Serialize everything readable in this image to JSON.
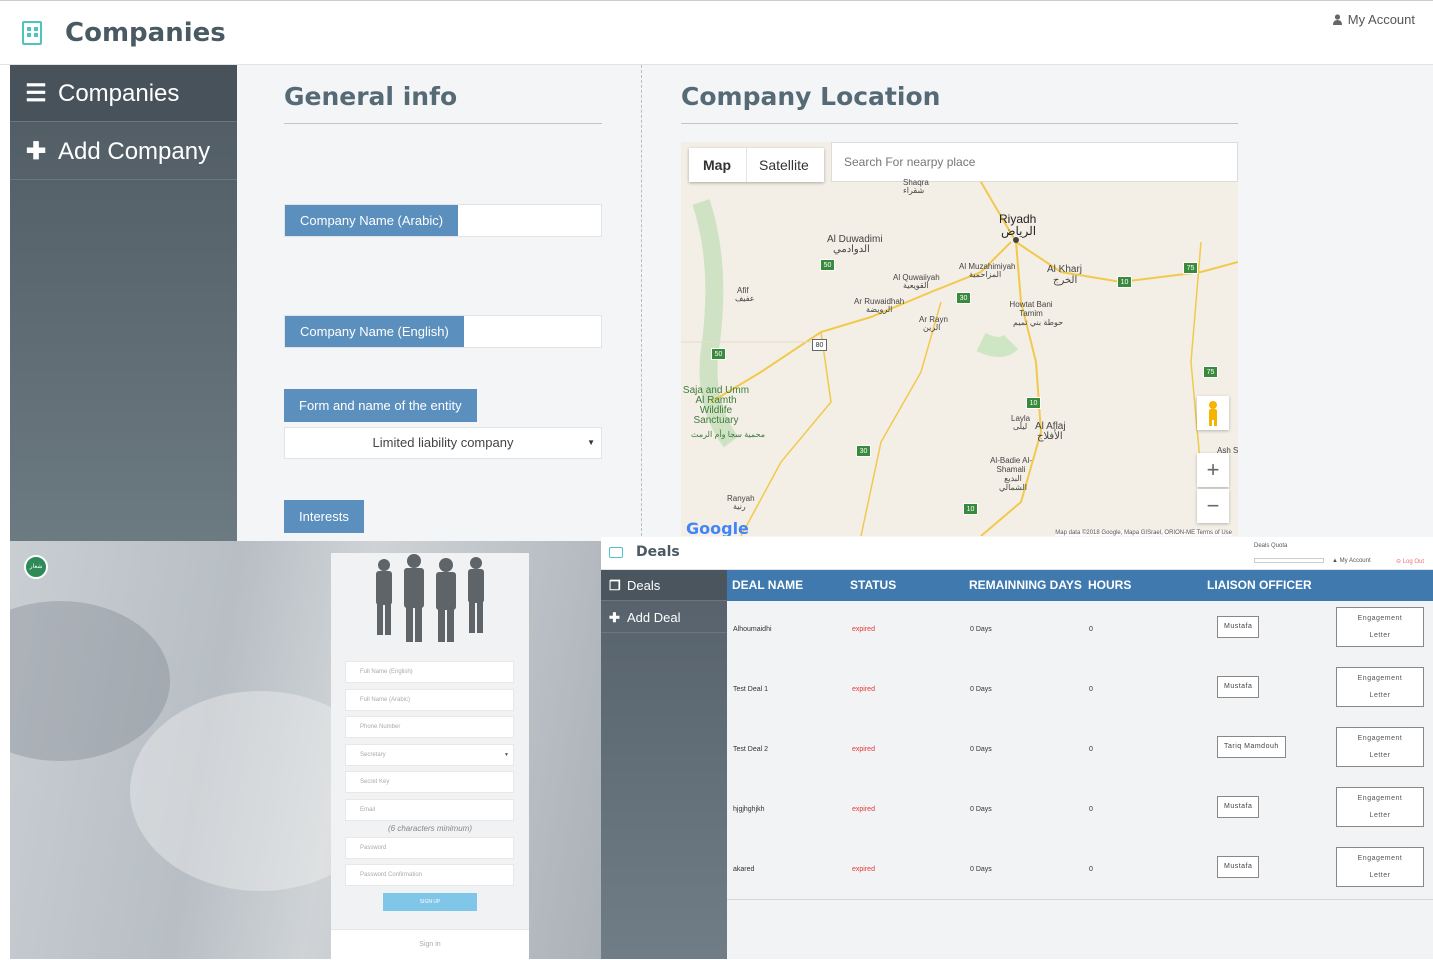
{
  "companies": {
    "header": {
      "title": "Companies",
      "account_label": "My Account"
    },
    "sidebar": {
      "items": [
        {
          "label": "Companies",
          "icon": "list-icon"
        },
        {
          "label": "Add Company",
          "icon": "plus-icon"
        }
      ]
    },
    "general_info": {
      "title": "General info",
      "company_name_arabic_label": "Company Name (Arabic)",
      "company_name_arabic_value": "",
      "company_name_english_label": "Company Name (English)",
      "company_name_english_value": "",
      "entity_label": "Form and name of the entity",
      "entity_value": "Limited liability company",
      "interests_label": "Interests"
    },
    "location": {
      "title": "Company Location",
      "search_placeholder": "Search For nearpy place",
      "map_type_map": "Map",
      "map_type_satellite": "Satellite",
      "zoom_in": "+",
      "zoom_out": "−",
      "google_logo": "Google",
      "attribution": "Map data ©2018 Google, Mapa GISrael, ORION-ME   Terms of Use",
      "places": {
        "riyadh": "Riyadh",
        "riyadh_ar": "الرياض",
        "al_duwadimi": "Al Duwadimi",
        "al_duwadimi_ar": "الدوادمي",
        "al_quwaiiyah": "Al Quwaiiyah",
        "al_quwaiiyah_ar": "القويعية",
        "al_muzahimiyah": "Al Muzahimiyah",
        "al_muzahimiyah_ar": "المزاحمية",
        "al_kharj": "Al Kharj",
        "al_kharj_ar": "الخرج",
        "afif": "Afif",
        "afif_ar": "عفيف",
        "ar_ruwaidhah": "Ar Ruwaidhah",
        "ar_ruwaidhah_ar": "الرويضة",
        "ar_rayn": "Ar Rayn",
        "ar_rayn_ar": "الرين",
        "howtat_bani_tamim": "Howtat Bani Tamim",
        "howtat_bani_tamim_ar": "حوطة بني تميم",
        "shaqra": "Shaqra",
        "shaqra_ar": "شقراء",
        "saja_umm_al_ramth": "Saja and Umm Al Ramth Wildlife Sanctuary",
        "saja_umm_al_ramth_ar": "محمية سجا وأم الرمث",
        "layla": "Layla",
        "layla_ar": "ليلى",
        "al_aflaj": "Al Aflaj",
        "al_aflaj_ar": "الأفلاج",
        "al_badie": "Al-Badie Al-Shamali",
        "al_badie_ar": "البديع الشمالي",
        "ranyah": "Ranyah",
        "ranyah_ar": "رنية",
        "ash_s": "Ash S"
      },
      "road_badges": [
        "50",
        "30",
        "80",
        "10",
        "75",
        "30",
        "10",
        "75",
        "10",
        "50",
        "30",
        "10"
      ]
    }
  },
  "signup": {
    "logo_text": "شعار",
    "fields": [
      "Full Name (English)",
      "Full Name (Arabic)",
      "Phone Number",
      "Secretary",
      "Secret Key",
      "Email"
    ],
    "password_hint": "(6 characters minimum)",
    "password_placeholder": "Password",
    "password_confirm_placeholder": "Password Confirmation",
    "submit_label": "SIGN UP",
    "footer_link": "Sign in"
  },
  "deals": {
    "header": {
      "title": "Deals",
      "quota_label": "Deals Quota",
      "account_label": "My Account",
      "logout_label": "Log Out"
    },
    "sidebar": {
      "items": [
        {
          "label": "Deals",
          "icon": "copy-icon"
        },
        {
          "label": "Add Deal",
          "icon": "plus-icon"
        }
      ]
    },
    "columns": [
      "DEAL NAME",
      "STATUS",
      "REMAINNING DAYS",
      "HOURS",
      "LIAISON OFFICER"
    ],
    "rows": [
      {
        "name": "Alhoumaidhi",
        "status": "expired",
        "days": "0 Days",
        "hours": "0",
        "officer": "Mustafa",
        "action": "Engagement Letter"
      },
      {
        "name": "Test Deal 1",
        "status": "expired",
        "days": "0 Days",
        "hours": "0",
        "officer": "Mustafa",
        "action": "Engagement Letter"
      },
      {
        "name": "Test Deal 2",
        "status": "expired",
        "days": "0 Days",
        "hours": "0",
        "officer": "Tariq Mamdouh",
        "action": "Engagement Letter"
      },
      {
        "name": "hjgjhghjkh",
        "status": "expired",
        "days": "0 Days",
        "hours": "0",
        "officer": "Mustafa",
        "action": "Engagement Letter"
      },
      {
        "name": "akared",
        "status": "expired",
        "days": "0 Days",
        "hours": "0",
        "officer": "Mustafa",
        "action": "Engagement Letter"
      }
    ],
    "colors": {
      "header": "#3f79ad",
      "expired": "#e53935"
    }
  }
}
